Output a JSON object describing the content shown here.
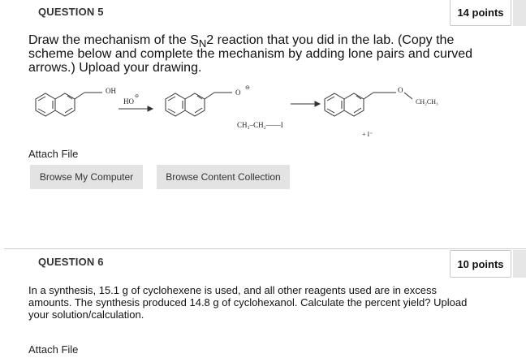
{
  "question5": {
    "title": "QUESTION 5",
    "points": "14 points",
    "prompt_part1": "Draw the mechanism of the S",
    "prompt_sub": "N",
    "prompt_part2": "2 reaction that you did in the lab.  (Copy the scheme below and complete the mechanism by adding lone pairs and curved arrows.)  Upload your drawing.",
    "scheme": {
      "oh_label": "OH",
      "ho_label": "HO",
      "o_label": "O",
      "reagent_label": "CH₃–CH₂——I",
      "product_o_label": "O",
      "product_chain_label": "CH₂CH₃",
      "iodide_label": "+ I⁻",
      "minus_sign": "⊖"
    },
    "attach_label": "Attach File",
    "browse_computer": "Browse My Computer",
    "browse_content": "Browse Content Collection"
  },
  "question6": {
    "title": "QUESTION 6",
    "points": "10 points",
    "prompt": "In a synthesis, 15.1 g of cyclohexene is used, and all other reagents used are in excess amounts.  The synthesis produced 14.8 g of cyclohexanol.  Calculate the percent yield?  Upload your solution/calculation.",
    "attach_label": "Attach File"
  }
}
